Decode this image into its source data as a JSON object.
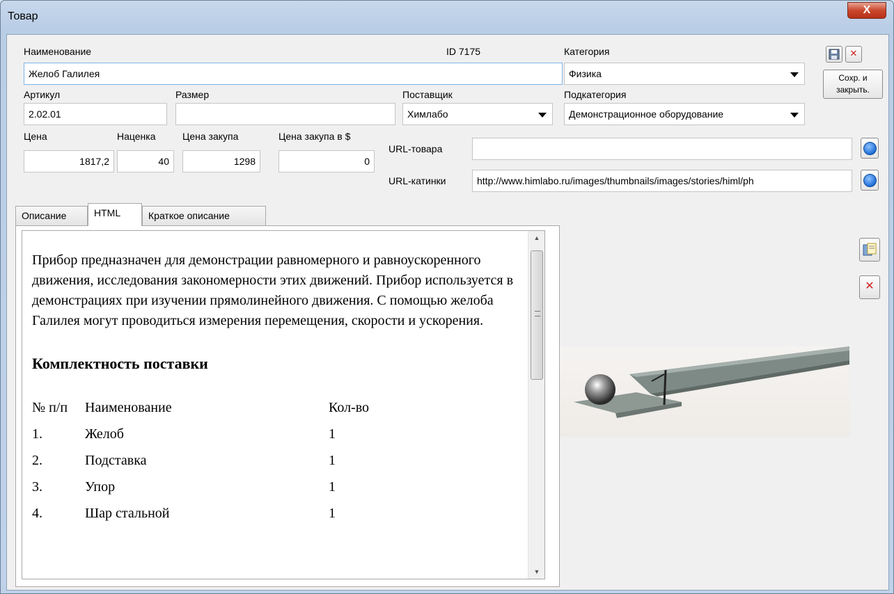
{
  "window": {
    "title": "Товар",
    "close_glyph": "X"
  },
  "fields": {
    "name_label": "Наименование",
    "name_value": "Желоб Галилея",
    "id_text": "ID  7175",
    "category_label": "Категория",
    "category_value": "Физика",
    "article_label": "Артикул",
    "article_value": "2.02.01",
    "size_label": "Размер",
    "size_value": "",
    "supplier_label": "Поставщик",
    "supplier_value": "Химлабо",
    "subcategory_label": "Подкатегория",
    "subcategory_value": "Демонстрационное оборудование",
    "price_label": "Цена",
    "price_value": "1817,2",
    "markup_label": "Наценка",
    "markup_value": "40",
    "purchase_label": "Цена закупа",
    "purchase_value": "1298",
    "purchase_usd_label": "Цена закупа в $",
    "purchase_usd_value": "0",
    "url_product_label": "URL-товара",
    "url_product_value": "",
    "url_image_label": "URL-катинки",
    "url_image_value": "http://www.himlabo.ru/images/thumbnails/images/stories/himl/ph"
  },
  "toolbar": {
    "save_close_line1": "Сохр. и",
    "save_close_line2": "закрыть."
  },
  "tabs": [
    {
      "label": "Описание"
    },
    {
      "label": "HTML"
    },
    {
      "label": "Краткое описание"
    }
  ],
  "description": {
    "paragraph": "Прибор предназначен для демонстрации равномерного и равноускоренного движения, исследования закономерности этих движений. Прибор используется в демонстрациях при изучении прямолинейного движения. С помощью желоба Галилея могут проводиться измерения перемещения, скорости и ускорения.",
    "heading": "Комплектность поставки",
    "table_header": {
      "num": "№ п/п",
      "name": "Наименование",
      "qty": "Кол-во"
    },
    "rows": [
      {
        "num": "1.",
        "name": "Желоб",
        "qty": "1"
      },
      {
        "num": "2.",
        "name": "Подставка",
        "qty": "1"
      },
      {
        "num": "3.",
        "name": "Упор",
        "qty": "1"
      },
      {
        "num": "4.",
        "name": "Шар стальной",
        "qty": "1"
      }
    ]
  },
  "icons": {
    "save": "floppy-disk-icon",
    "delete": "red-x-icon",
    "browser": "globe-icon",
    "load_image": "folder-image-icon"
  },
  "colors": {
    "accent": "#7eb4ea",
    "close_button": "#c9472d",
    "delete_red": "#d02020"
  }
}
